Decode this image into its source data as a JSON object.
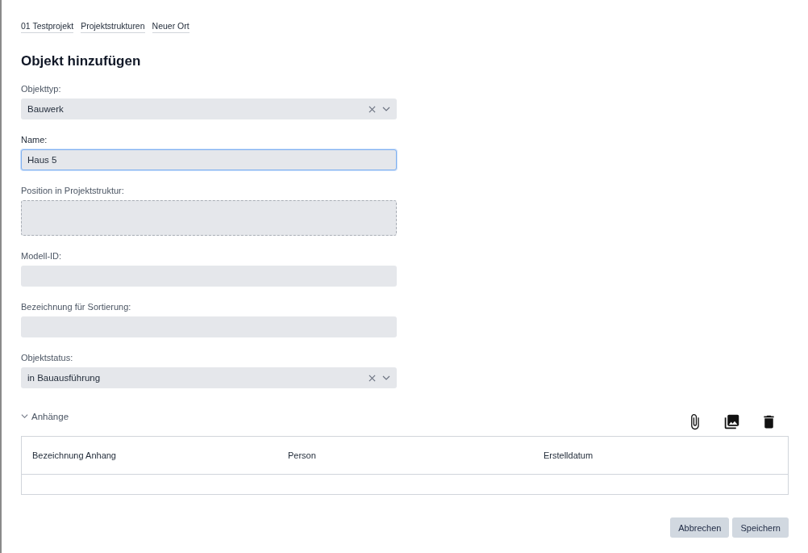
{
  "breadcrumbs": [
    "01 Testprojekt",
    "Projektstrukturen",
    "Neuer Ort"
  ],
  "title": "Objekt hinzufügen",
  "fields": [
    {
      "kind": "select",
      "label": "Objekttyp:",
      "value": "Bauwerk",
      "focused": false
    },
    {
      "kind": "text",
      "label": "Name:",
      "value": "Haus 5",
      "focused": true
    },
    {
      "kind": "area",
      "label": "Position in Projektstruktur:",
      "focused": false
    },
    {
      "kind": "text",
      "label": "Modell-ID:",
      "focused": false
    },
    {
      "kind": "text",
      "label": "Bezeichnung für Sortierung:",
      "focused": false
    },
    {
      "kind": "select",
      "label": "Objektstatus:",
      "value": "in Bauausführung",
      "focused": false
    }
  ],
  "attachments": {
    "label": "Anhänge",
    "expanded": true,
    "columns": [
      "Bezeichnung Anhang",
      "Person",
      "Erstelldatum"
    ]
  },
  "buttons": [
    "Abbrechen",
    "Speichern"
  ]
}
